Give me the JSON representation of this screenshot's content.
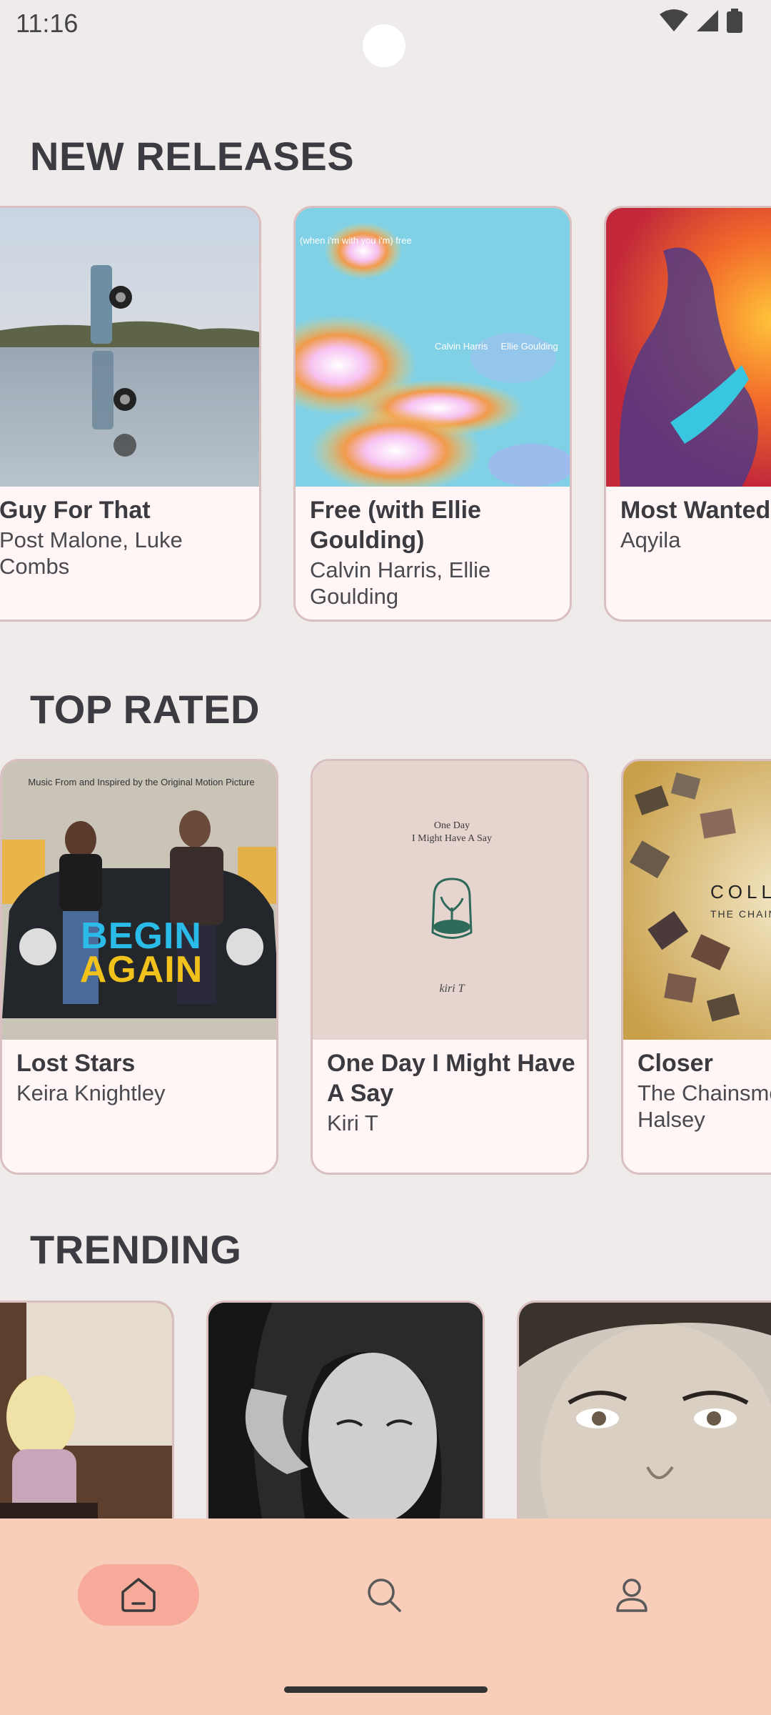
{
  "status": {
    "time": "11:16"
  },
  "sections": {
    "new_releases": {
      "title": "NEW RELEASES",
      "cards": [
        {
          "title": "Guy For That",
          "subtitle": "Post Malone, Luke Combs"
        },
        {
          "title": "Free (with Ellie Goulding)",
          "subtitle": "Calvin Harris, Ellie Goulding",
          "art_text": {
            "top": "(when i'm with you i'm) free",
            "right": "Calvin Harris     Ellie Goulding"
          }
        },
        {
          "title": "Most Wanted",
          "subtitle": "Aqyila"
        }
      ]
    },
    "top_rated": {
      "title": "TOP RATED",
      "cards": [
        {
          "title": "Lost Stars",
          "subtitle": "Keira Knightley",
          "art_text": {
            "top": "Music From and Inspired by the Original Motion Picture",
            "line1": "BEGIN",
            "line2": "AGAIN"
          }
        },
        {
          "title": "One Day I Might Have A Say",
          "subtitle": "Kiri T",
          "art_text": {
            "title": "One Day\nI Might Have A Say",
            "sig": "kiri T"
          }
        },
        {
          "title": "Closer",
          "subtitle": "The Chainsmokers, Halsey",
          "art_text": {
            "main": "COLL",
            "sub": "THE CHAINS"
          }
        }
      ]
    },
    "trending": {
      "title": "TRENDING"
    }
  },
  "nav": {
    "items": [
      {
        "name": "home",
        "icon": "home-icon",
        "active": true
      },
      {
        "name": "search",
        "icon": "search-icon",
        "active": false
      },
      {
        "name": "profile",
        "icon": "profile-icon",
        "active": false
      }
    ]
  },
  "colors": {
    "background": "#efebeb",
    "card": "#fff6f5",
    "nav": "#f8cdb9",
    "nav_active": "#f7a99a"
  }
}
